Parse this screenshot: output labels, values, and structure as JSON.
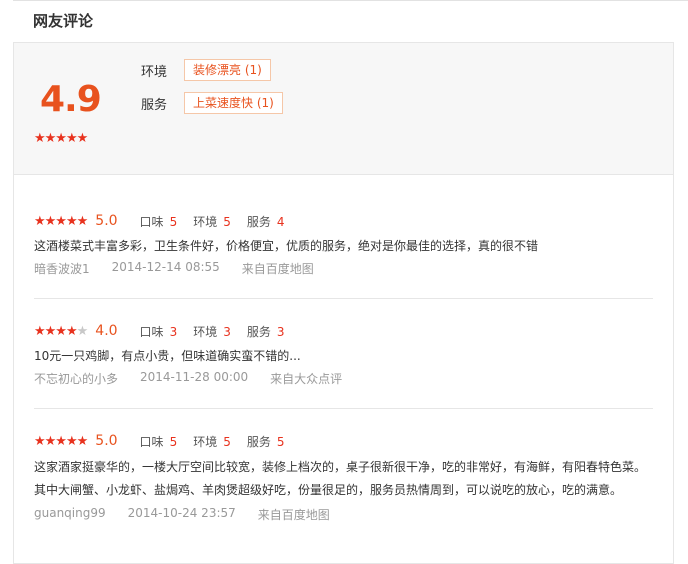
{
  "section_title": "网友评论",
  "summary": {
    "score": "4.9",
    "stars": "★★★★★",
    "tags": [
      {
        "label": "环境",
        "tag": "装修漂亮 (1)"
      },
      {
        "label": "服务",
        "tag": "上菜速度快 (1)"
      }
    ]
  },
  "review_dims": {
    "taste": "口味",
    "env": "环境",
    "service": "服务"
  },
  "reviews": [
    {
      "stars_on": "★★★★★",
      "stars_off": "",
      "score": "5.0",
      "taste": "5",
      "env": "5",
      "service": "4",
      "text": "这酒楼菜式丰富多彩，卫生条件好，价格便宜，优质的服务，绝对是你最佳的选择，真的很不错",
      "user": "暗香波波1",
      "time": "2014-12-14 08:55",
      "source": "来自百度地图"
    },
    {
      "stars_on": "★★★★",
      "stars_off": "★",
      "score": "4.0",
      "taste": "3",
      "env": "3",
      "service": "3",
      "text": "10元一只鸡脚，有点小贵，但味道确实蛮不错的...",
      "user": "不忘初心的小多",
      "time": "2014-11-28 00:00",
      "source": "来自大众点评"
    },
    {
      "stars_on": "★★★★★",
      "stars_off": "",
      "score": "5.0",
      "taste": "5",
      "env": "5",
      "service": "5",
      "text": "这家酒家挺豪华的，一楼大厅空间比较宽，装修上档次的，桌子很新很干净，吃的非常好，有海鲜，有阳春特色菜。其中大闸蟹、小龙虾、盐焗鸡、羊肉煲超级好吃，份量很足的，服务员热情周到，可以说吃的放心，吃的满意。",
      "user": "guanqing99",
      "time": "2014-10-24 23:57",
      "source": "来自百度地图"
    }
  ]
}
